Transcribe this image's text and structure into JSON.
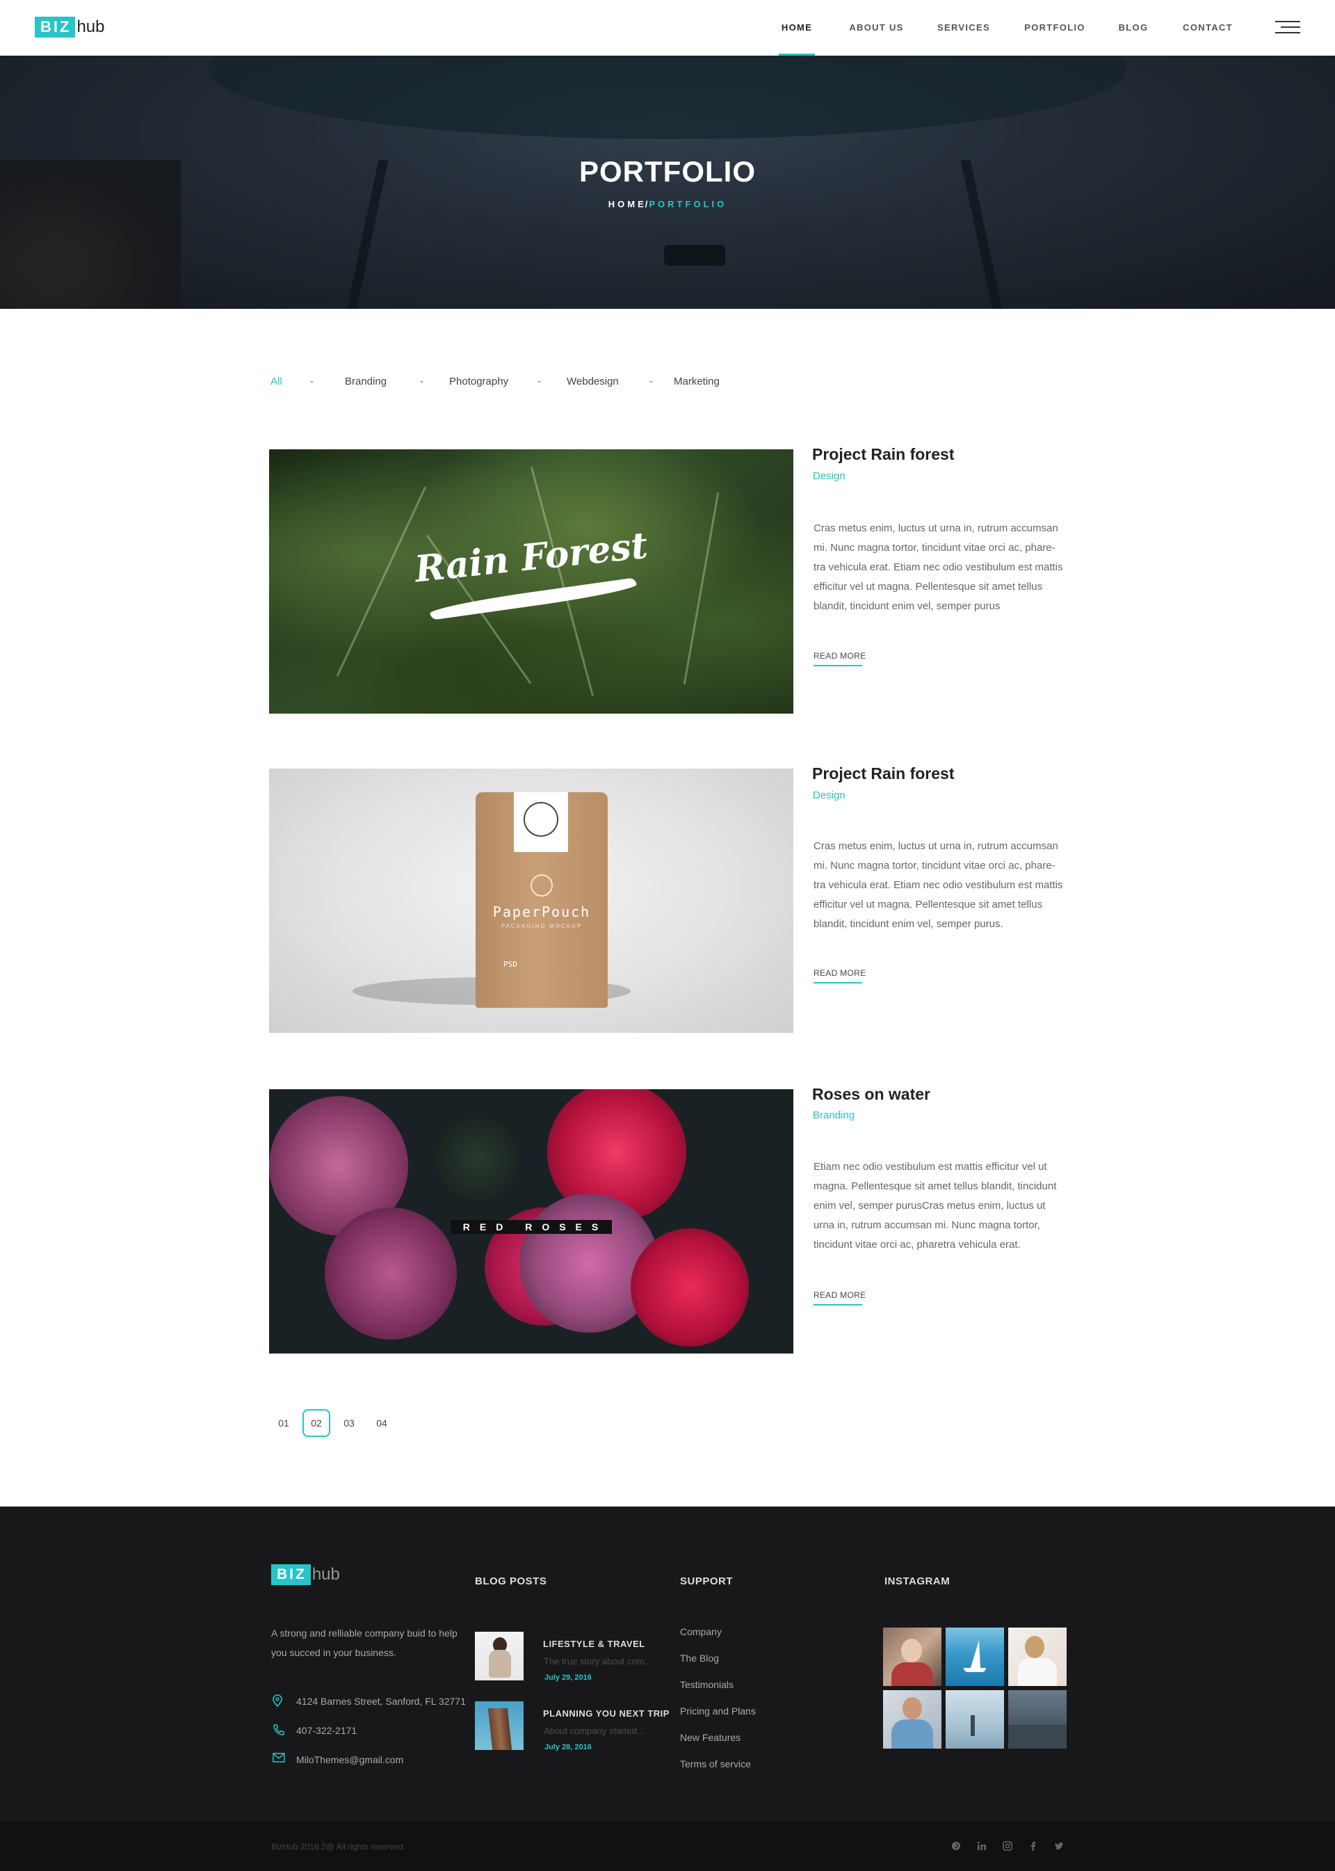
{
  "header": {
    "logo": {
      "biz": "BIZ",
      "hub": "hub"
    },
    "nav": [
      {
        "label": "HOME",
        "active": true
      },
      {
        "label": "ABOUT US"
      },
      {
        "label": "SERVICES"
      },
      {
        "label": "PORTFOLIO"
      },
      {
        "label": "BLOG"
      },
      {
        "label": "CONTACT"
      }
    ],
    "menu_icon": "hamburger-menu-icon"
  },
  "hero": {
    "title": "PORTFOLIO",
    "breadcrumb": {
      "home": "HOME",
      "separator": "/",
      "current": "PORTFOLIO"
    }
  },
  "filter": {
    "items": [
      "All",
      "Branding",
      "Photography",
      "Webdesign",
      "Marketing"
    ],
    "separator": "-",
    "active": "All"
  },
  "projects": [
    {
      "title": "Project Rain forest",
      "category": "Design",
      "description": "Cras metus enim, luctus ut urna in, rutrum accumsan mi. Nunc magna tortor, tincidunt vitae orci ac, phare-tra vehicula erat. Etiam nec odio vestibulum est mattis efficitur vel ut magna. Pellentesque sit amet tellus blandit, tincidunt enim vel, semper purus",
      "read_more": "READ MORE",
      "image_text": "Rain Forest"
    },
    {
      "title": "Project Rain forest",
      "category": "Design",
      "description": "Cras metus enim, luctus ut urna in, rutrum accumsan mi. Nunc magna tortor, tincidunt vitae orci ac, phare-tra vehicula erat. Etiam nec odio vestibulum est mattis efficitur vel ut magna. Pellentesque sit amet tellus blandit, tincidunt enim vel, semper purus.",
      "read_more": "READ MORE",
      "image_text": "PaperPouch",
      "image_subtext": "PACKAGING MOCKUP",
      "image_side_text": "PSD"
    },
    {
      "title": "Roses on water",
      "category": "Branding",
      "description": "Etiam nec odio vestibulum est mattis efficitur vel ut magna. Pellentesque sit amet tellus blandit, tincidunt enim vel, semper purusCras metus enim, luctus ut urna in, rutrum accumsan mi. Nunc magna tortor, tincidunt vitae orci ac, pharetra vehicula erat.",
      "read_more": "READ MORE",
      "image_text": "RED ROSES"
    }
  ],
  "pagination": {
    "pages": [
      "01",
      "02",
      "03",
      "04"
    ],
    "active": "02"
  },
  "footer": {
    "logo": {
      "biz": "BIZ",
      "hub": "hub"
    },
    "about": "A strong and relliable company buid to help you succed in your business.",
    "address": "4124 Barnes Street, Sanford, FL 32771",
    "phone": "407-322-2171",
    "email": "MiloThemes@gmail.com",
    "blog_heading": "BLOG POSTS",
    "blog_posts": [
      {
        "title": "LIFESTYLE & TRAVEL",
        "snippet": "The true story about com...",
        "date": "July 29, 2016"
      },
      {
        "title": "PLANNING YOU NEXT TRIP",
        "snippet": "About company started...",
        "date": "July 28, 2016"
      }
    ],
    "support_heading": "SUPPORT",
    "support_links": [
      "Company",
      "The Blog",
      "Testimonials",
      "Pricing and Plans",
      "New Features",
      "Terms of service"
    ],
    "instagram_heading": "INSTAGRAM",
    "copyright": "BizHub 2016 2@ All rights reserved",
    "social_icons": [
      "pinterest-icon",
      "linkedin-icon",
      "instagram-icon",
      "facebook-icon",
      "twitter-icon"
    ]
  },
  "colors": {
    "accent": "#27c4c8",
    "footer_bg": "#18181a",
    "bottom_bar_bg": "#111113"
  }
}
